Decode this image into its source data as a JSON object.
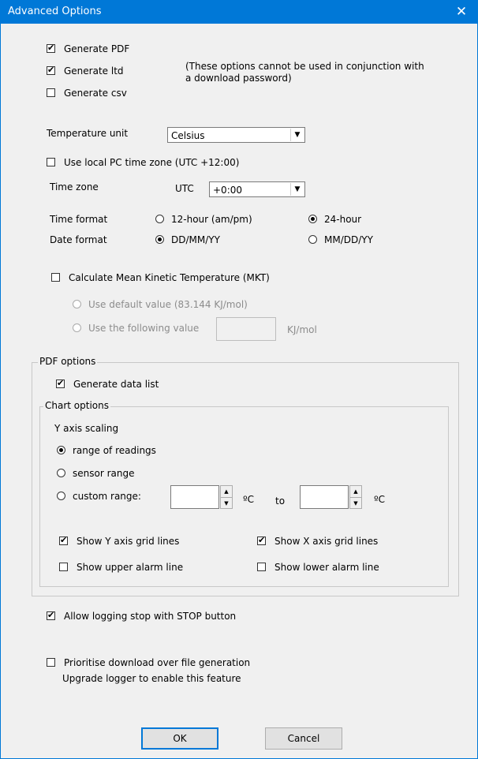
{
  "window": {
    "title": "Advanced Options",
    "close_glyph": "✕"
  },
  "output": {
    "generate_pdf": {
      "label": "Generate PDF",
      "checked": true
    },
    "generate_ltd": {
      "label": "Generate ltd",
      "checked": true
    },
    "generate_csv": {
      "label": "Generate csv",
      "checked": false
    },
    "note_line1": "(These options cannot be used in conjunction with",
    "note_line2": "a download password)"
  },
  "temperature": {
    "label": "Temperature unit",
    "value": "Celsius"
  },
  "timezone": {
    "use_local_label": "Use local PC time zone (UTC +12:00)",
    "use_local_checked": false,
    "label": "Time zone",
    "prefix": "UTC",
    "value": "+0:00"
  },
  "time_format": {
    "label": "Time format",
    "option_12": "12-hour (am/pm)",
    "option_24": "24-hour",
    "selected": "24-hour"
  },
  "date_format": {
    "label": "Date format",
    "option_dmy": "DD/MM/YY",
    "option_mdy": "MM/DD/YY",
    "selected": "DD/MM/YY"
  },
  "mkt": {
    "label": "Calculate Mean Kinetic Temperature (MKT)",
    "checked": false,
    "default_label": "Use default value (83.144 KJ/mol)",
    "custom_label": "Use the following value",
    "unit": "KJ/mol",
    "value": ""
  },
  "pdf_options": {
    "label": "PDF options",
    "data_list": {
      "label": "Generate data list",
      "checked": true
    },
    "chart": {
      "label": "Chart options",
      "y_scaling_label": "Y axis scaling",
      "range_of_readings": "range of readings",
      "sensor_range": "sensor range",
      "custom_range": "custom range:",
      "selected": "range of readings",
      "from_value": "",
      "to_value": "",
      "unit": "ºC",
      "to_label": "to",
      "show_y_grid": {
        "label": "Show Y axis grid lines",
        "checked": true
      },
      "show_x_grid": {
        "label": "Show X axis grid lines",
        "checked": true
      },
      "show_upper_alarm": {
        "label": "Show upper alarm line",
        "checked": false
      },
      "show_lower_alarm": {
        "label": "Show lower alarm line",
        "checked": false
      }
    }
  },
  "stop_button": {
    "label": "Allow logging stop with STOP button",
    "checked": true
  },
  "prioritise": {
    "label": "Prioritise download over file generation",
    "checked": false,
    "note": "Upgrade logger to enable this feature"
  },
  "buttons": {
    "ok": "OK",
    "cancel": "Cancel"
  }
}
